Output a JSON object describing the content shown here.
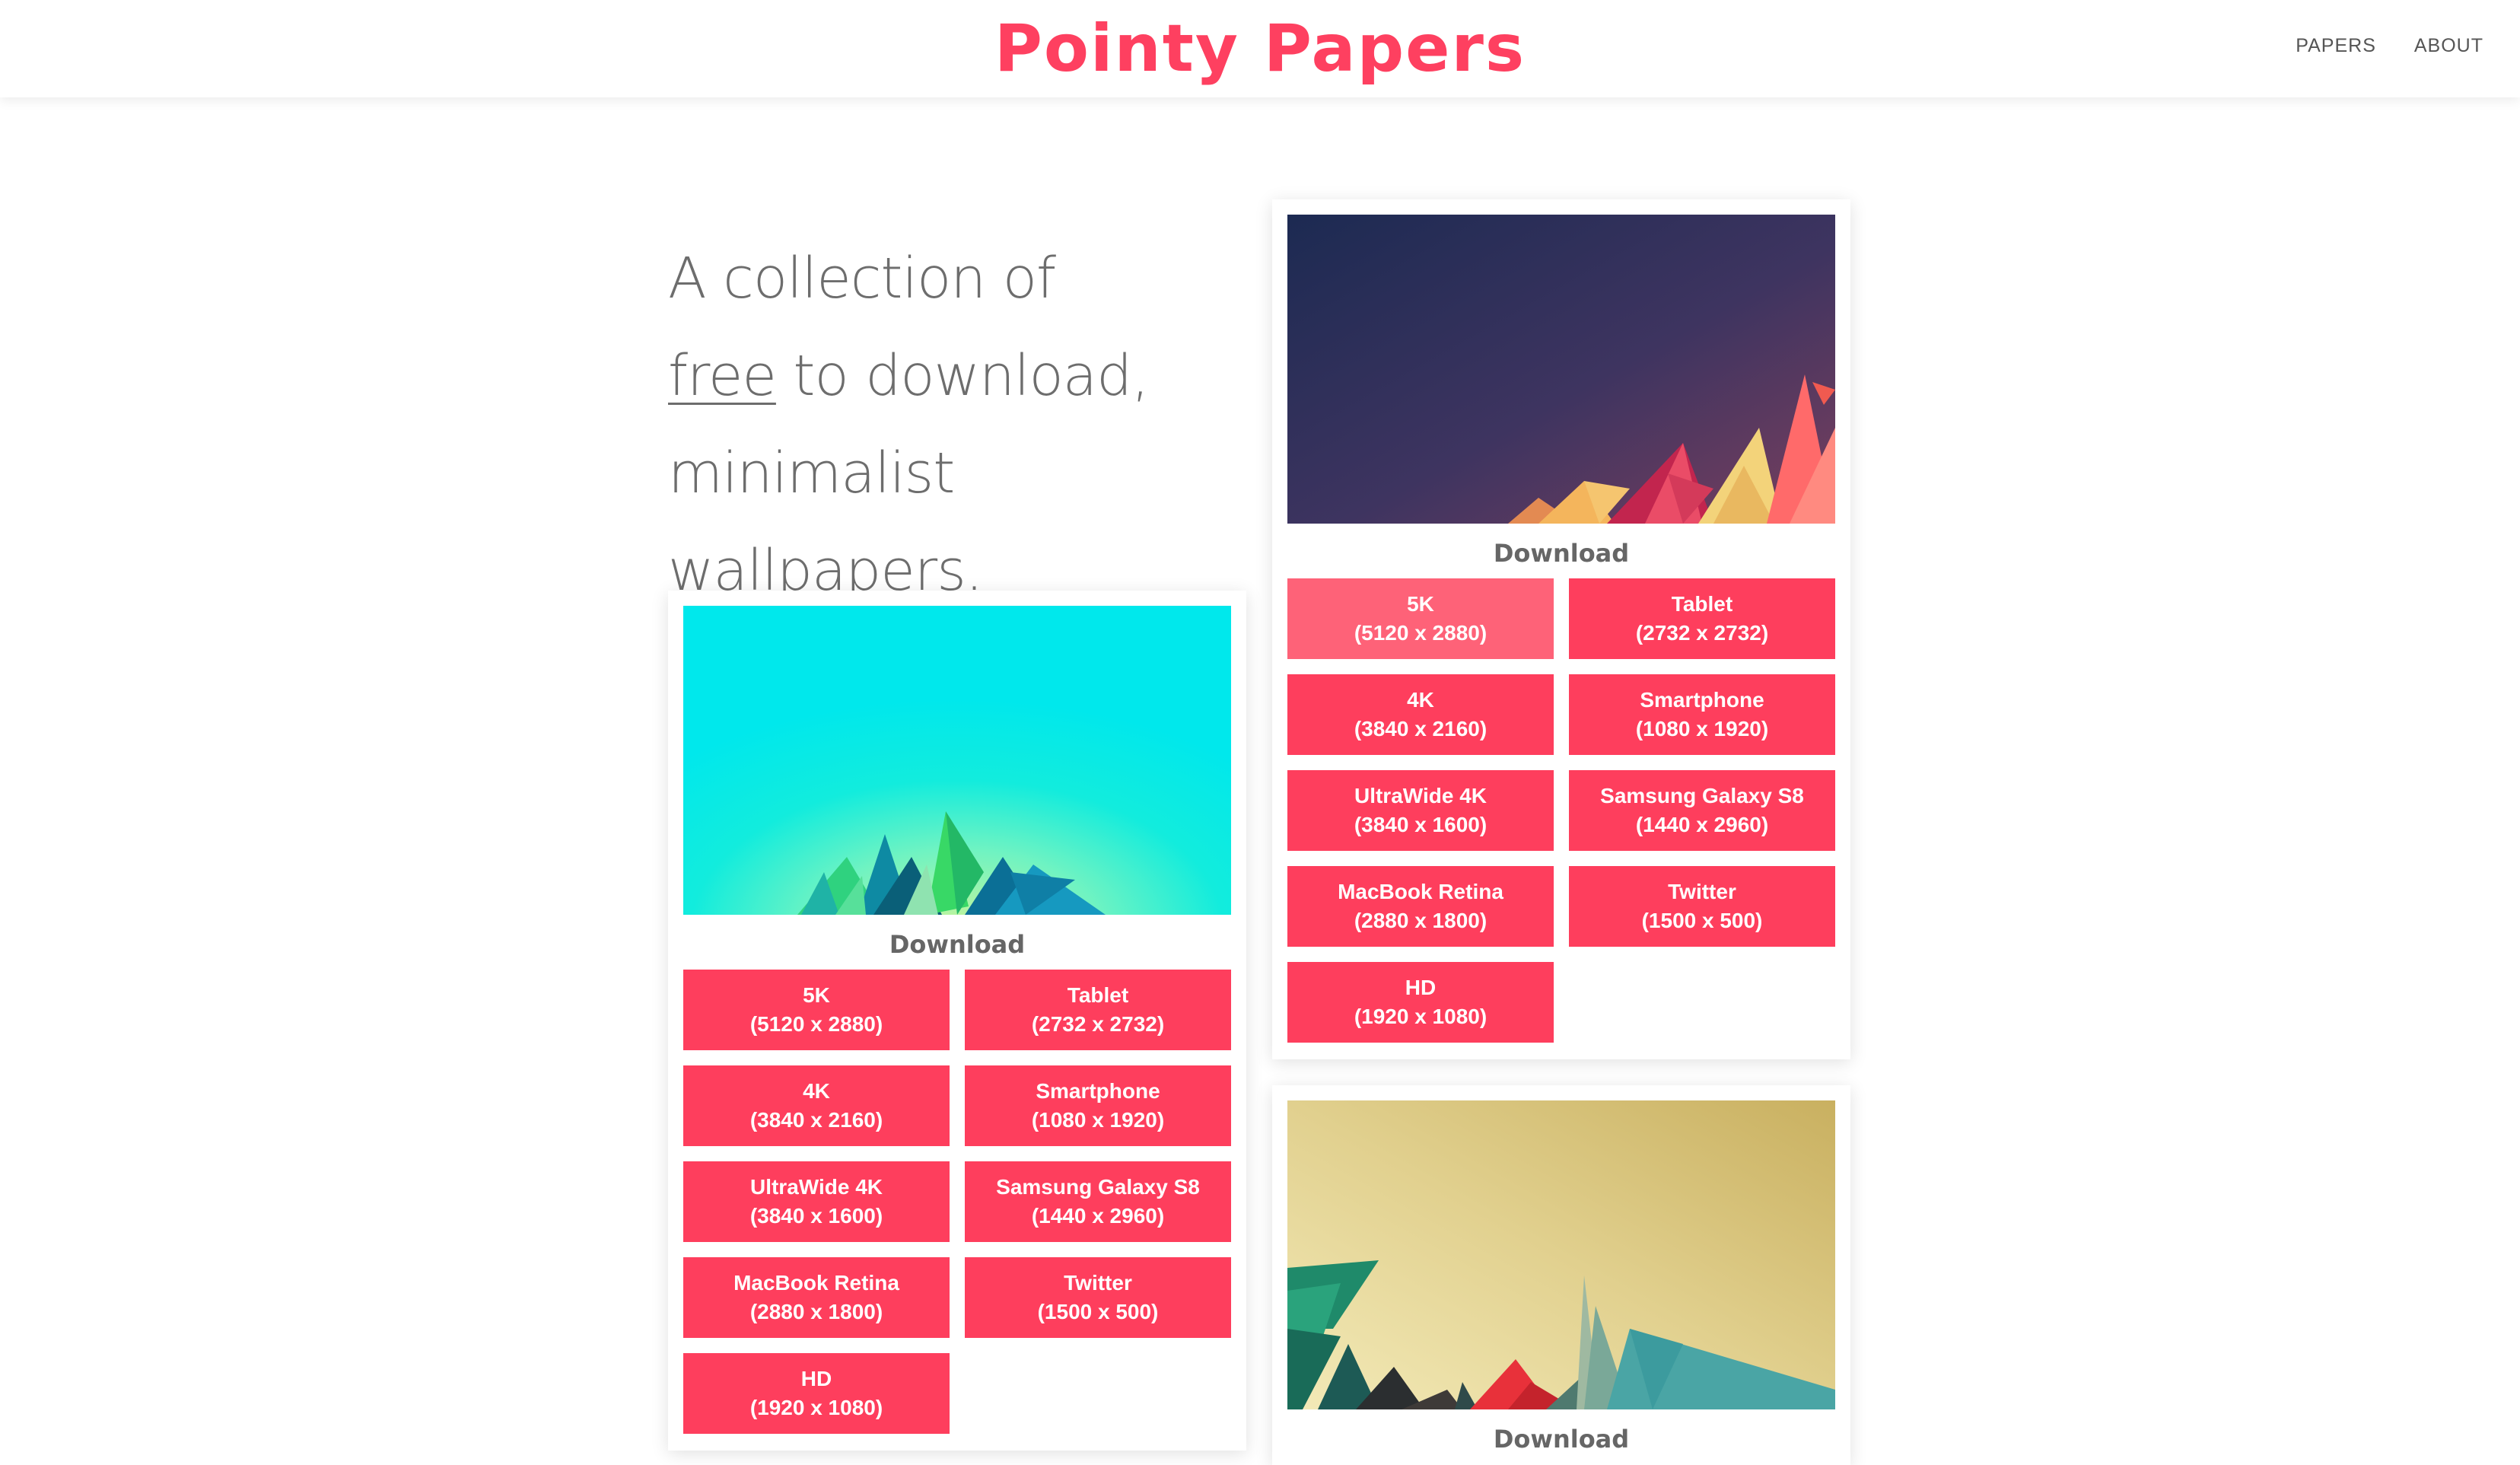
{
  "header": {
    "logo": "Pointy Papers",
    "nav": [
      "PAPERS",
      "ABOUT"
    ]
  },
  "tagline": {
    "line1": "A collection of",
    "free": "free",
    "line2_rest": " to download,",
    "line3": "minimalist wallpapers."
  },
  "download_label": "Download",
  "colors": {
    "accent": "#fe3e5d",
    "accent_hover": "#fe6278",
    "text": "#6d6d6d"
  },
  "wallpapers": [
    {
      "name": "cyan",
      "downloads": [
        {
          "label": "5K",
          "size": "(5120 x 2880)"
        },
        {
          "label": "Tablet",
          "size": "(2732 x 2732)"
        },
        {
          "label": "4K",
          "size": "(3840 x 2160)"
        },
        {
          "label": "Smartphone",
          "size": "(1080 x 1920)"
        },
        {
          "label": "UltraWide 4K",
          "size": "(3840 x 1600)"
        },
        {
          "label": "Samsung Galaxy S8",
          "size": "(1440 x 2960)"
        },
        {
          "label": "MacBook Retina",
          "size": "(2880 x 1800)"
        },
        {
          "label": "Twitter",
          "size": "(1500 x 500)"
        },
        {
          "label": "HD",
          "size": "(1920 x 1080)"
        }
      ]
    },
    {
      "name": "dusk",
      "downloads": [
        {
          "label": "5K",
          "size": "(5120 x 2880)"
        },
        {
          "label": "Tablet",
          "size": "(2732 x 2732)"
        },
        {
          "label": "4K",
          "size": "(3840 x 2160)"
        },
        {
          "label": "Smartphone",
          "size": "(1080 x 1920)"
        },
        {
          "label": "UltraWide 4K",
          "size": "(3840 x 1600)"
        },
        {
          "label": "Samsung Galaxy S8",
          "size": "(1440 x 2960)"
        },
        {
          "label": "MacBook Retina",
          "size": "(2880 x 1800)"
        },
        {
          "label": "Twitter",
          "size": "(1500 x 500)"
        },
        {
          "label": "HD",
          "size": "(1920 x 1080)"
        }
      ]
    },
    {
      "name": "sand"
    }
  ]
}
